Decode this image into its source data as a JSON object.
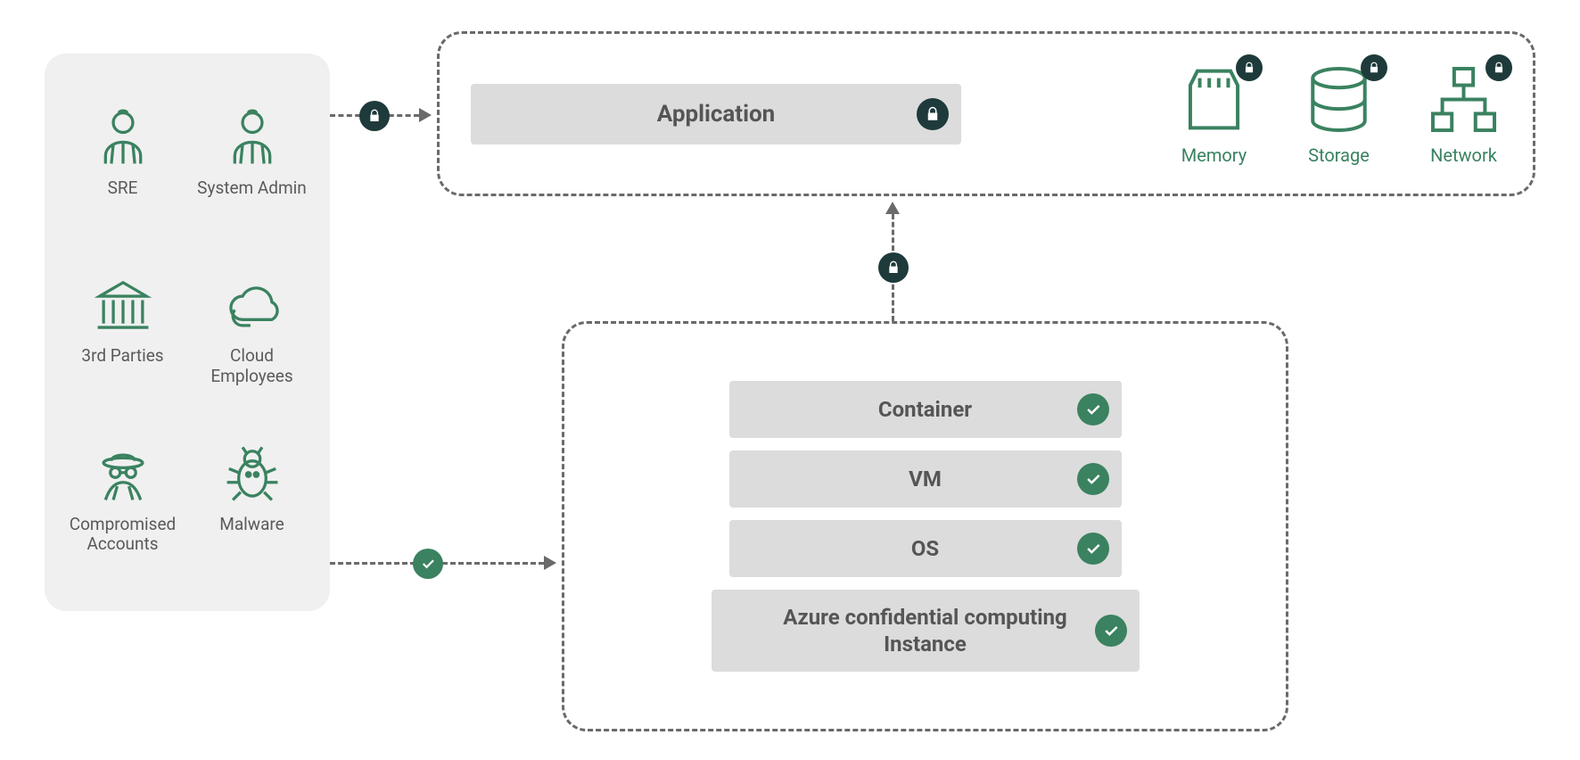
{
  "users": [
    {
      "label": "SRE",
      "icon": "person"
    },
    {
      "label": "System Admin",
      "icon": "person"
    },
    {
      "label": "3rd Parties",
      "icon": "institution"
    },
    {
      "label": "Cloud Employees",
      "icon": "cloud"
    },
    {
      "label": "Compromised Accounts",
      "icon": "spy"
    },
    {
      "label": "Malware",
      "icon": "bug"
    }
  ],
  "top": {
    "application_label": "Application",
    "resources": [
      {
        "label": "Memory",
        "icon": "memory"
      },
      {
        "label": "Storage",
        "icon": "storage"
      },
      {
        "label": "Network",
        "icon": "network"
      }
    ]
  },
  "stack": [
    {
      "label": "Container"
    },
    {
      "label": "VM"
    },
    {
      "label": "OS"
    },
    {
      "label": "Azure confidential computing Instance",
      "wide": true
    }
  ],
  "arrows": {
    "top_arrow_badge": "lock",
    "bottom_arrow_badge": "check",
    "vertical_badge": "lock"
  }
}
